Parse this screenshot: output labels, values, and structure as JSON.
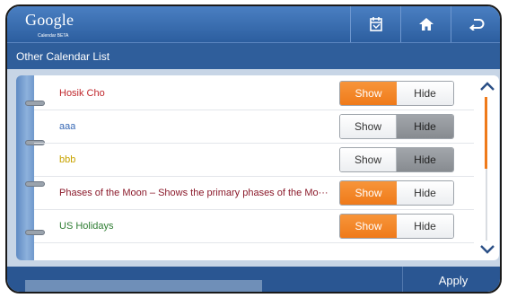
{
  "header": {
    "logo_text": "Google",
    "logo_sub": "Calendar BETA",
    "icons": [
      "calendar-icon",
      "home-icon",
      "back-icon"
    ]
  },
  "subbar": {
    "title": "Other Calendar List"
  },
  "list": {
    "items": [
      {
        "label": "Hosik Cho",
        "color": "#c0282d",
        "show": "Show",
        "hide": "Hide",
        "state": "show"
      },
      {
        "label": "aaa",
        "color": "#3768b5",
        "show": "Show",
        "hide": "Hide",
        "state": "hide"
      },
      {
        "label": "bbb",
        "color": "#c8a300",
        "show": "Show",
        "hide": "Hide",
        "state": "hide"
      },
      {
        "label": "Phases of the Moon – Shows the primary phases of the Mo···",
        "color": "#8b1a2b",
        "show": "Show",
        "hide": "Hide",
        "state": "show"
      },
      {
        "label": "US Holidays",
        "color": "#2e7d32",
        "show": "Show",
        "hide": "Hide",
        "state": "show"
      }
    ]
  },
  "footer": {
    "apply_label": "Apply"
  },
  "colors": {
    "accent": "#ef7a1a",
    "header": "#2c5e9f"
  }
}
